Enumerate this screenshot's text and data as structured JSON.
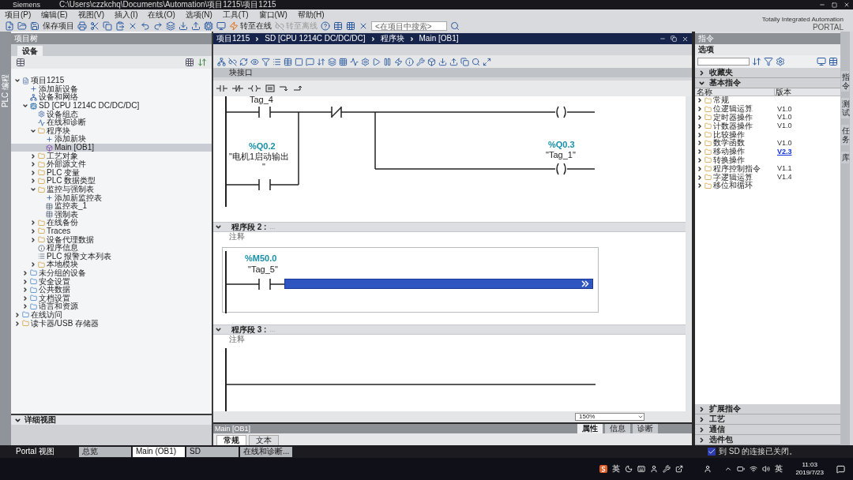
{
  "title_bar": {
    "app": "Siemens",
    "path": "C:\\Users\\czzkchq\\Documents\\Automation\\项目1215\\项目1215"
  },
  "menu": [
    "项目(P)",
    "编辑(E)",
    "视图(V)",
    "插入(I)",
    "在线(O)",
    "选项(N)",
    "工具(T)",
    "窗口(W)",
    "帮助(H)"
  ],
  "toolbar": {
    "save_label": "保存项目",
    "online": {
      "label": "转至在线",
      "disabled": false
    },
    "offline": {
      "label": "转至离线",
      "disabled": true
    },
    "search": {
      "placeholder": "<在项目中搜索>"
    }
  },
  "brand": {
    "tagline": "Totally Integrated Automation",
    "product": "PORTAL"
  },
  "left_strip": {
    "label": "PLC 编程"
  },
  "project_tree": {
    "title": "项目树",
    "tab": "设备",
    "items": [
      {
        "label": "项目1215",
        "kind": "project",
        "expanded": true,
        "selected": false,
        "children": [
          {
            "label": "添加新设备",
            "kind": "add",
            "selected": false
          },
          {
            "label": "设备和网络",
            "kind": "network",
            "selected": false
          },
          {
            "label": "SD [CPU 1214C DC/DC/DC]",
            "kind": "plc",
            "expanded": true,
            "selected": false,
            "children": [
              {
                "label": "设备组态",
                "kind": "config",
                "selected": false
              },
              {
                "label": "在线和诊断",
                "kind": "diag",
                "selected": false
              },
              {
                "label": "程序块",
                "kind": "folder",
                "expanded": true,
                "selected": false,
                "children": [
                  {
                    "label": "添加新块",
                    "kind": "add",
                    "selected": false
                  },
                  {
                    "label": "Main [OB1]",
                    "kind": "block",
                    "selected": true
                  }
                ]
              },
              {
                "label": "工艺对象",
                "kind": "folder",
                "expanded": false,
                "selected": false
              },
              {
                "label": "外部源文件",
                "kind": "folder",
                "expanded": false,
                "selected": false
              },
              {
                "label": "PLC 变量",
                "kind": "folder",
                "expanded": false,
                "selected": false
              },
              {
                "label": "PLC 数据类型",
                "kind": "folder",
                "expanded": false,
                "selected": false
              },
              {
                "label": "监控与强制表",
                "kind": "folder",
                "expanded": true,
                "selected": false,
                "children": [
                  {
                    "label": "添加新监控表",
                    "kind": "add",
                    "selected": false
                  },
                  {
                    "label": "监控表_1",
                    "kind": "table",
                    "selected": false
                  },
                  {
                    "label": "强制表",
                    "kind": "table",
                    "selected": false
                  }
                ]
              },
              {
                "label": "在线备份",
                "kind": "folder",
                "expanded": false,
                "selected": false
              },
              {
                "label": "Traces",
                "kind": "folder",
                "expanded": false,
                "selected": false
              },
              {
                "label": "设备代理数据",
                "kind": "folder",
                "expanded": false,
                "selected": false
              },
              {
                "label": "程序信息",
                "kind": "info",
                "selected": false
              },
              {
                "label": "PLC 报警文本列表",
                "kind": "list",
                "selected": false
              },
              {
                "label": "本地模块",
                "kind": "folder",
                "expanded": false,
                "selected": false
              }
            ]
          },
          {
            "label": "未分组的设备",
            "kind": "group",
            "expanded": false,
            "selected": false
          },
          {
            "label": "安全设置",
            "kind": "group",
            "expanded": false,
            "selected": false
          },
          {
            "label": "公共数据",
            "kind": "group",
            "expanded": false,
            "selected": false
          },
          {
            "label": "文档设置",
            "kind": "group",
            "expanded": false,
            "selected": false
          },
          {
            "label": "语言和资源",
            "kind": "group",
            "expanded": false,
            "selected": false
          }
        ]
      },
      {
        "label": "在线访问",
        "kind": "group",
        "expanded": false,
        "selected": false
      },
      {
        "label": "读卡器/USB 存储器",
        "kind": "folder",
        "expanded": false,
        "selected": false
      }
    ]
  },
  "detail_view": {
    "label": "详细视图",
    "expanded": true
  },
  "editor": {
    "breadcrumb": [
      "项目1215",
      "SD [CPU 1214C DC/DC/DC]",
      "程序块",
      "Main [OB1]"
    ],
    "interface_label": "块接口",
    "networks": [
      {
        "kind": "latch",
        "top_contact_name": "Tag_4",
        "branch_address": "%Q0.2",
        "branch_name_lines": [
          "\"电机1启动输出",
          "\""
        ],
        "coil_address": "%Q0.3",
        "coil_name": "\"Tag_1\""
      },
      {
        "kind": "box",
        "title": "程序段 2 :",
        "dots": "...",
        "comment": "注释",
        "contact_address": "%M50.0",
        "contact_name": "\"Tag_5\"",
        "box_selected": true
      },
      {
        "kind": "empty",
        "title": "程序段 3 :",
        "dots": "...",
        "comment": "注释"
      }
    ],
    "zoom": "150%"
  },
  "properties": {
    "title": "Main [OB1]",
    "tabs": [
      {
        "label": "常规",
        "selected": true
      },
      {
        "label": "文本",
        "selected": false
      }
    ],
    "inspector_tabs": [
      {
        "label": "属性",
        "selected": true
      },
      {
        "label": "信息",
        "selected": false
      },
      {
        "label": "诊断",
        "selected": false
      }
    ]
  },
  "instructions": {
    "title": "指令",
    "options_label": "选项",
    "sections_top": [
      {
        "label": "收藏夹",
        "expanded": false
      },
      {
        "label": "基本指令",
        "expanded": true
      }
    ],
    "columns": [
      "名称",
      "版本"
    ],
    "rows": [
      {
        "name": "常规"
      },
      {
        "name": "位逻辑运算",
        "version": "V1.0",
        "linked": false
      },
      {
        "name": "定时器操作",
        "version": "V1.0",
        "linked": false
      },
      {
        "name": "计数器操作",
        "version": "V1.0",
        "linked": false
      },
      {
        "name": "比较操作"
      },
      {
        "name": "数学函数",
        "version": "V1.0",
        "linked": false
      },
      {
        "name": "移动操作",
        "version": "V2.3",
        "linked": true
      },
      {
        "name": "转换操作"
      },
      {
        "name": "程序控制指令",
        "version": "V1.1",
        "linked": false
      },
      {
        "name": "字逻辑运算",
        "version": "V1.4",
        "linked": false
      },
      {
        "name": "移位和循环"
      }
    ],
    "sections_bottom": [
      {
        "label": "扩展指令",
        "expanded": false
      },
      {
        "label": "工艺",
        "expanded": false
      },
      {
        "label": "通信",
        "expanded": false
      },
      {
        "label": "选件包",
        "expanded": false
      }
    ]
  },
  "right_strip": [
    "指令",
    "测试",
    "任务",
    "库"
  ],
  "portal_bar": {
    "portal_label": "Portal 视图",
    "tabs": [
      {
        "label": "总览",
        "selected": false
      },
      {
        "label": "Main (OB1)",
        "selected": true
      },
      {
        "label": "SD",
        "selected": false
      },
      {
        "label": "在线和诊断...",
        "selected": false
      }
    ]
  },
  "status": {
    "message": "到 SD 的连接已关闭。"
  },
  "taskbar": {
    "ime": "英",
    "lang": "英",
    "time": "11:03",
    "date": "2019/7/23"
  }
}
